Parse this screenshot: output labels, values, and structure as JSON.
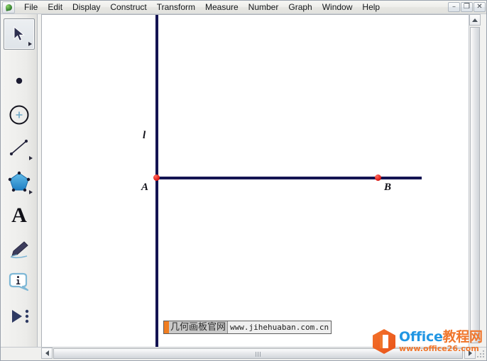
{
  "window": {
    "app_icon": "geometers-sketchpad-icon",
    "controls": [
      {
        "name": "minimize",
        "glyph": "–"
      },
      {
        "name": "restore",
        "glyph": "❐"
      },
      {
        "name": "close",
        "glyph": "✕"
      }
    ]
  },
  "menubar": {
    "items": [
      {
        "label": "File"
      },
      {
        "label": "Edit"
      },
      {
        "label": "Display"
      },
      {
        "label": "Construct"
      },
      {
        "label": "Transform"
      },
      {
        "label": "Measure"
      },
      {
        "label": "Number"
      },
      {
        "label": "Graph"
      },
      {
        "label": "Window"
      },
      {
        "label": "Help"
      }
    ]
  },
  "toolbox": {
    "tools": [
      {
        "name": "arrow-select-tool",
        "icon": "arrow-cursor-icon",
        "selected": true,
        "has_flyout": true,
        "label": ""
      },
      {
        "name": "point-tool",
        "icon": "point-icon",
        "selected": false,
        "has_flyout": false,
        "label": ""
      },
      {
        "name": "compass-circle-tool",
        "icon": "circle-compass-icon",
        "selected": false,
        "has_flyout": false,
        "label": ""
      },
      {
        "name": "straightedge-tool",
        "icon": "line-segment-icon",
        "selected": false,
        "has_flyout": true,
        "label": ""
      },
      {
        "name": "polygon-tool",
        "icon": "pentagon-icon",
        "selected": false,
        "has_flyout": true,
        "label": ""
      },
      {
        "name": "text-tool",
        "icon": "text-a-icon",
        "selected": false,
        "has_flyout": false,
        "label": "A"
      },
      {
        "name": "marker-tool",
        "icon": "marker-pen-icon",
        "selected": false,
        "has_flyout": false,
        "label": ""
      },
      {
        "name": "information-tool",
        "icon": "info-bubble-icon",
        "selected": false,
        "has_flyout": false,
        "label": ""
      },
      {
        "name": "custom-tool",
        "icon": "play-triangle-dots-icon",
        "selected": false,
        "has_flyout": false,
        "label": ""
      }
    ]
  },
  "canvas": {
    "objects": [
      {
        "name": "line-l",
        "type": "vertical-line",
        "label": "l",
        "color": "#131352"
      },
      {
        "name": "segment-ab",
        "type": "horizontal-segment",
        "label": "",
        "color": "#131352"
      },
      {
        "name": "point-a",
        "type": "point",
        "label": "A",
        "color": "#e01b16"
      },
      {
        "name": "point-b",
        "type": "point",
        "label": "B",
        "color": "#e01b16"
      }
    ],
    "labels": {
      "line": "l",
      "point_a": "A",
      "point_b": "B"
    }
  },
  "watermarks": {
    "site": {
      "cn_text": "几何画板官网",
      "url": "www.jihehuaban.com.cn",
      "accent_color": "#f07d20"
    },
    "office": {
      "title_en": "Office",
      "title_cn": "教程网",
      "url": "www.office26.com",
      "brand_color": "#f0762c",
      "text_color": "#2196e3"
    }
  },
  "scrollbars": {
    "vertical": {
      "name": "vertical-scrollbar"
    },
    "horizontal": {
      "name": "horizontal-scrollbar"
    }
  }
}
